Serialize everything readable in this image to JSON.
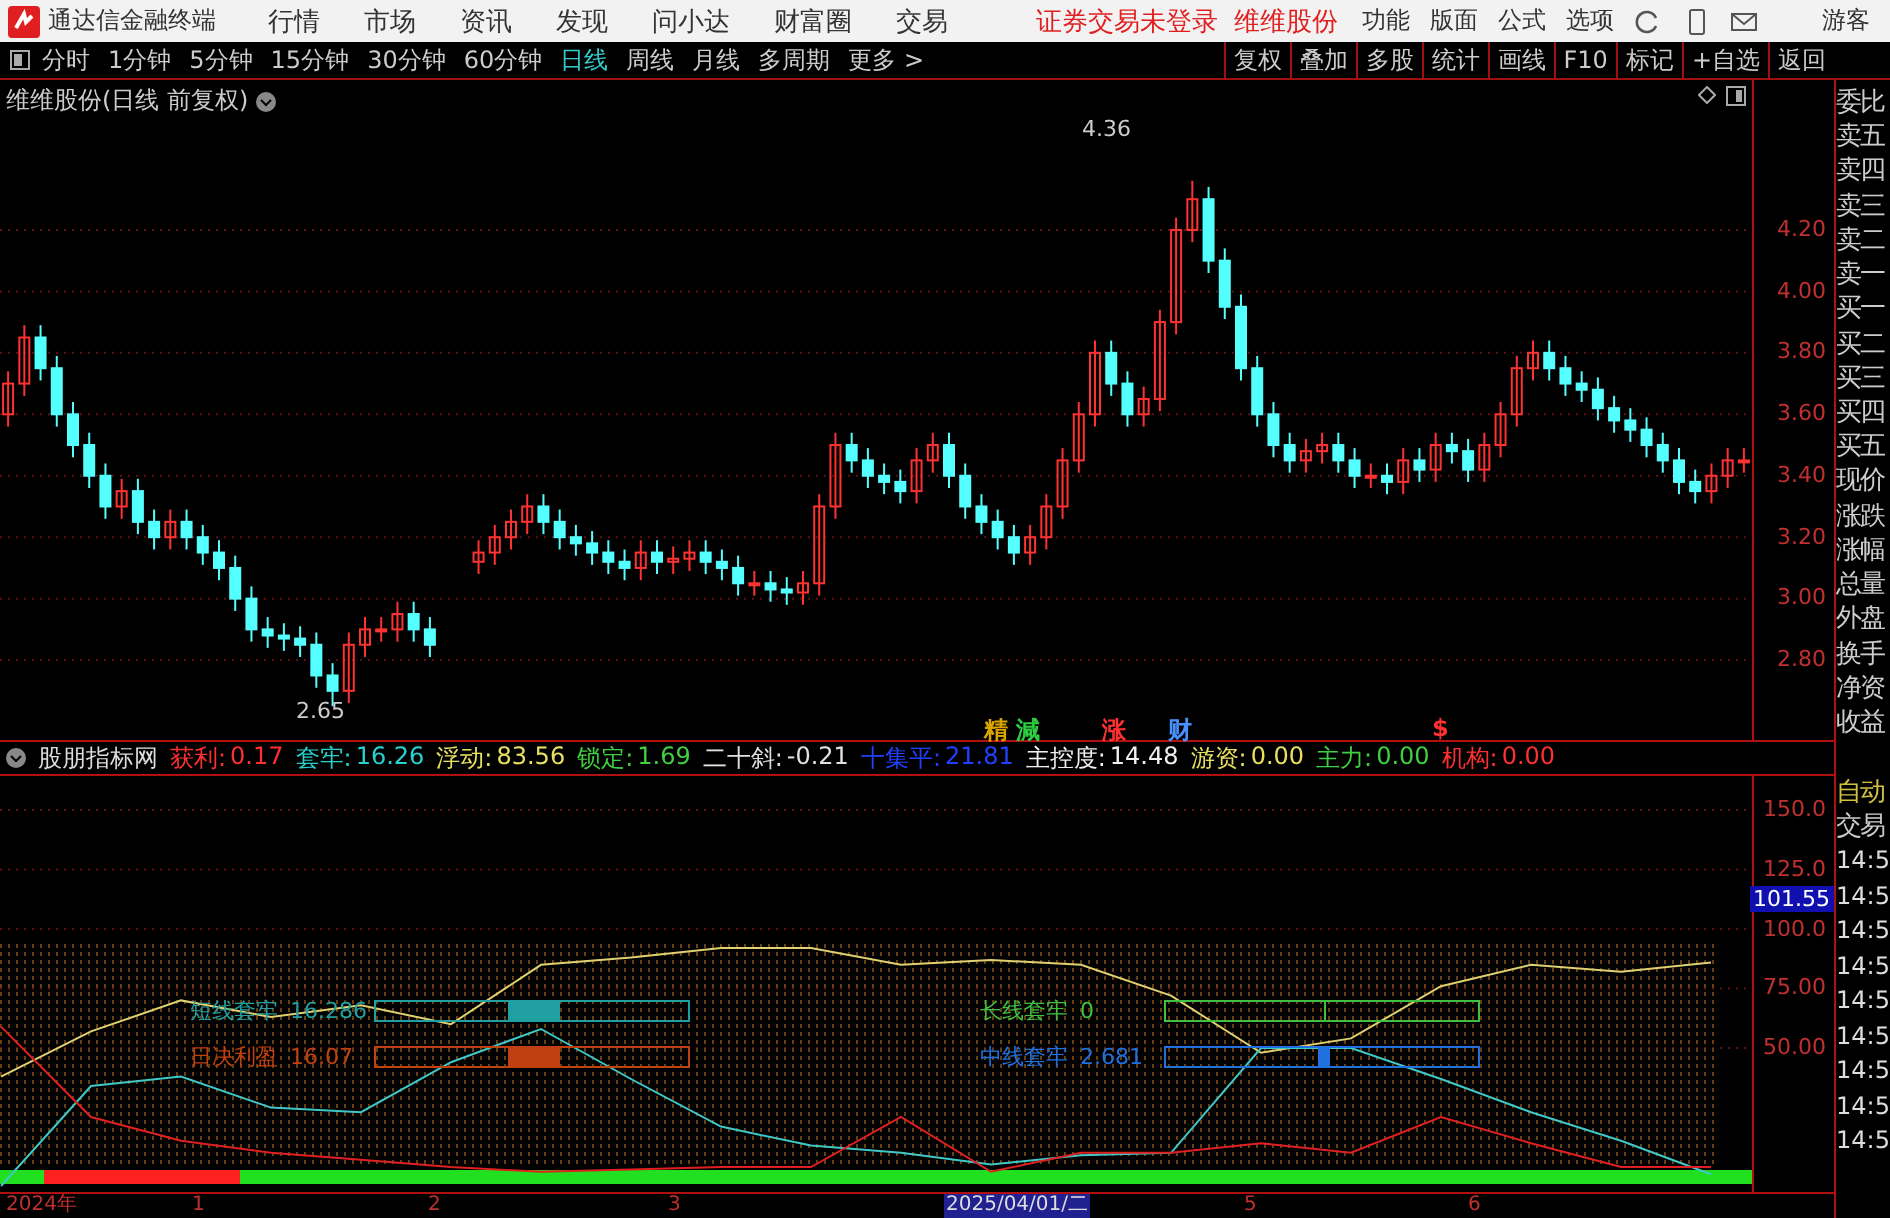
{
  "menu_bar": {
    "app_title": "通达信金融终端",
    "items": [
      "行情",
      "市场",
      "资讯",
      "发现",
      "问小达",
      "财富圈",
      "交易"
    ],
    "status": [
      "证券交易未登录",
      "维维股份"
    ],
    "right_items": [
      "功能",
      "版面",
      "公式",
      "选项"
    ],
    "user": "游客"
  },
  "period_tabs": [
    {
      "label": "分时",
      "selected": false
    },
    {
      "label": "1分钟",
      "selected": false
    },
    {
      "label": "5分钟",
      "selected": false
    },
    {
      "label": "15分钟",
      "selected": false
    },
    {
      "label": "30分钟",
      "selected": false
    },
    {
      "label": "60分钟",
      "selected": false
    },
    {
      "label": "日线",
      "selected": true
    },
    {
      "label": "周线",
      "selected": false
    },
    {
      "label": "月线",
      "selected": false
    },
    {
      "label": "多周期",
      "selected": false
    },
    {
      "label": "更多 >",
      "selected": false
    }
  ],
  "tool_buttons": [
    "复权",
    "叠加",
    "多股",
    "统计",
    "画线",
    "F10",
    "标记",
    "+自选",
    "返回"
  ],
  "chart": {
    "title": "维维股份(日线 前复权)",
    "high_label": "4.36",
    "low_label": "2.65",
    "chart_data": {
      "type": "candlestick",
      "ylim": [
        2.54,
        4.688
      ],
      "grid": true,
      "yticks": [
        {
          "value": 4.2,
          "label": "4.20"
        },
        {
          "value": 4.0,
          "label": "4.00"
        },
        {
          "value": 3.8,
          "label": "3.80"
        },
        {
          "value": 3.6,
          "label": "3.60"
        },
        {
          "value": 3.4,
          "label": "3.40"
        },
        {
          "value": 3.2,
          "label": "3.20"
        },
        {
          "value": 3.0,
          "label": "3.00"
        },
        {
          "value": 2.8,
          "label": "2.80"
        }
      ],
      "ohlc": [
        [
          3.6,
          3.74,
          3.56,
          3.7
        ],
        [
          3.7,
          3.89,
          3.66,
          3.85
        ],
        [
          3.85,
          3.89,
          3.71,
          3.75
        ],
        [
          3.75,
          3.79,
          3.56,
          3.6
        ],
        [
          3.6,
          3.64,
          3.46,
          3.5
        ],
        [
          3.5,
          3.54,
          3.36,
          3.4
        ],
        [
          3.4,
          3.44,
          3.26,
          3.3
        ],
        [
          3.3,
          3.39,
          3.26,
          3.35
        ],
        [
          3.35,
          3.39,
          3.21,
          3.25
        ],
        [
          3.25,
          3.29,
          3.16,
          3.2
        ],
        [
          3.2,
          3.29,
          3.16,
          3.25
        ],
        [
          3.25,
          3.29,
          3.16,
          3.2
        ],
        [
          3.2,
          3.24,
          3.11,
          3.15
        ],
        [
          3.15,
          3.19,
          3.06,
          3.1
        ],
        [
          3.1,
          3.14,
          2.96,
          3.0
        ],
        [
          3.0,
          3.04,
          2.86,
          2.9
        ],
        [
          2.9,
          2.94,
          2.84,
          2.88
        ],
        [
          2.88,
          2.92,
          2.83,
          2.87
        ],
        [
          2.87,
          2.91,
          2.81,
          2.85
        ],
        [
          2.85,
          2.89,
          2.71,
          2.75
        ],
        [
          2.75,
          2.79,
          2.65,
          2.7
        ],
        [
          2.7,
          2.89,
          2.66,
          2.85
        ],
        [
          2.85,
          2.94,
          2.81,
          2.9
        ],
        [
          2.9,
          2.94,
          2.86,
          2.9
        ],
        [
          2.9,
          2.99,
          2.86,
          2.95
        ],
        [
          2.95,
          2.99,
          2.86,
          2.9
        ],
        [
          2.9,
          2.94,
          2.81,
          2.85
        ],
        null,
        null,
        [
          3.12,
          3.19,
          3.08,
          3.15
        ],
        [
          3.15,
          3.24,
          3.11,
          3.2
        ],
        [
          3.2,
          3.29,
          3.16,
          3.25
        ],
        [
          3.25,
          3.34,
          3.21,
          3.3
        ],
        [
          3.3,
          3.34,
          3.21,
          3.25
        ],
        [
          3.25,
          3.29,
          3.16,
          3.2
        ],
        [
          3.2,
          3.24,
          3.14,
          3.18
        ],
        [
          3.18,
          3.22,
          3.11,
          3.15
        ],
        [
          3.15,
          3.19,
          3.08,
          3.12
        ],
        [
          3.12,
          3.16,
          3.06,
          3.1
        ],
        [
          3.1,
          3.19,
          3.06,
          3.15
        ],
        [
          3.15,
          3.19,
          3.08,
          3.12
        ],
        [
          3.12,
          3.17,
          3.08,
          3.13
        ],
        [
          3.13,
          3.19,
          3.09,
          3.15
        ],
        [
          3.15,
          3.19,
          3.08,
          3.12
        ],
        [
          3.12,
          3.16,
          3.06,
          3.1
        ],
        [
          3.1,
          3.14,
          3.01,
          3.05
        ],
        [
          3.05,
          3.09,
          3.01,
          3.05
        ],
        [
          3.05,
          3.09,
          2.99,
          3.03
        ],
        [
          3.03,
          3.07,
          2.98,
          3.02
        ],
        [
          3.02,
          3.09,
          2.98,
          3.05
        ],
        [
          3.05,
          3.34,
          3.01,
          3.3
        ],
        [
          3.3,
          3.54,
          3.26,
          3.5
        ],
        [
          3.5,
          3.54,
          3.41,
          3.45
        ],
        [
          3.45,
          3.49,
          3.36,
          3.4
        ],
        [
          3.4,
          3.44,
          3.34,
          3.38
        ],
        [
          3.38,
          3.42,
          3.31,
          3.35
        ],
        [
          3.35,
          3.49,
          3.31,
          3.45
        ],
        [
          3.45,
          3.54,
          3.41,
          3.5
        ],
        [
          3.5,
          3.54,
          3.36,
          3.4
        ],
        [
          3.4,
          3.44,
          3.26,
          3.3
        ],
        [
          3.3,
          3.34,
          3.21,
          3.25
        ],
        [
          3.25,
          3.29,
          3.16,
          3.2
        ],
        [
          3.2,
          3.24,
          3.11,
          3.15
        ],
        [
          3.15,
          3.24,
          3.11,
          3.2
        ],
        [
          3.2,
          3.34,
          3.16,
          3.3
        ],
        [
          3.3,
          3.49,
          3.26,
          3.45
        ],
        [
          3.45,
          3.64,
          3.41,
          3.6
        ],
        [
          3.6,
          3.84,
          3.56,
          3.8
        ],
        [
          3.8,
          3.84,
          3.66,
          3.7
        ],
        [
          3.7,
          3.74,
          3.56,
          3.6
        ],
        [
          3.6,
          3.69,
          3.56,
          3.65
        ],
        [
          3.65,
          3.94,
          3.61,
          3.9
        ],
        [
          3.9,
          4.24,
          3.86,
          4.2
        ],
        [
          4.2,
          4.36,
          4.16,
          4.3
        ],
        [
          4.3,
          4.34,
          4.06,
          4.1
        ],
        [
          4.1,
          4.14,
          3.91,
          3.95
        ],
        [
          3.95,
          3.99,
          3.71,
          3.75
        ],
        [
          3.75,
          3.79,
          3.56,
          3.6
        ],
        [
          3.6,
          3.64,
          3.46,
          3.5
        ],
        [
          3.5,
          3.54,
          3.41,
          3.45
        ],
        [
          3.45,
          3.52,
          3.41,
          3.48
        ],
        [
          3.48,
          3.54,
          3.44,
          3.5
        ],
        [
          3.5,
          3.54,
          3.41,
          3.45
        ],
        [
          3.45,
          3.49,
          3.36,
          3.4
        ],
        [
          3.4,
          3.44,
          3.36,
          3.4
        ],
        [
          3.4,
          3.44,
          3.34,
          3.38
        ],
        [
          3.38,
          3.49,
          3.34,
          3.45
        ],
        [
          3.45,
          3.49,
          3.38,
          3.42
        ],
        [
          3.42,
          3.54,
          3.38,
          3.5
        ],
        [
          3.5,
          3.54,
          3.44,
          3.48
        ],
        [
          3.48,
          3.52,
          3.38,
          3.42
        ],
        [
          3.42,
          3.54,
          3.38,
          3.5
        ],
        [
          3.5,
          3.64,
          3.46,
          3.6
        ],
        [
          3.6,
          3.79,
          3.56,
          3.75
        ],
        [
          3.75,
          3.84,
          3.71,
          3.8
        ],
        [
          3.8,
          3.84,
          3.71,
          3.75
        ],
        [
          3.75,
          3.79,
          3.66,
          3.7
        ],
        [
          3.7,
          3.74,
          3.64,
          3.68
        ],
        [
          3.68,
          3.72,
          3.58,
          3.62
        ],
        [
          3.62,
          3.66,
          3.54,
          3.58
        ],
        [
          3.58,
          3.62,
          3.51,
          3.55
        ],
        [
          3.55,
          3.59,
          3.46,
          3.5
        ],
        [
          3.5,
          3.54,
          3.41,
          3.45
        ],
        [
          3.45,
          3.49,
          3.34,
          3.38
        ],
        [
          3.38,
          3.42,
          3.31,
          3.35
        ],
        [
          3.35,
          3.44,
          3.31,
          3.4
        ],
        [
          3.4,
          3.49,
          3.36,
          3.45
        ],
        [
          3.45,
          3.49,
          3.41,
          3.45
        ]
      ]
    },
    "event_marks": [
      {
        "text": "精",
        "color": "#d9a400"
      },
      {
        "text": "減",
        "color": "#2ecc40"
      },
      {
        "text": "涨",
        "color": "#ff3030"
      },
      {
        "text": "财",
        "color": "#4a90ff"
      },
      {
        "text": "$",
        "color": "#ff3030"
      }
    ]
  },
  "indicator": {
    "name": "股朋指标网",
    "readings": [
      {
        "label": "获利:",
        "value": "0.17",
        "color": "#ff3030"
      },
      {
        "label": "套牢:",
        "value": "16.26",
        "color": "#2ad0d0"
      },
      {
        "label": "浮动:",
        "value": "83.56",
        "color": "#e8e060"
      },
      {
        "label": "锁定:",
        "value": "1.69",
        "color": "#40d040"
      },
      {
        "label": "二十斜:",
        "value": "-0.21",
        "color": "#e0e0e0"
      },
      {
        "label": "十集平:",
        "value": "21.81",
        "color": "#2040ff"
      },
      {
        "label": "主控度:",
        "value": "14.48",
        "color": "#f0f0f0"
      },
      {
        "label": "游资:",
        "value": "0.00",
        "color": "#e8e060"
      },
      {
        "label": "主力:",
        "value": "0.00",
        "color": "#40d040"
      },
      {
        "label": "机构:",
        "value": "0.00",
        "color": "#ff3030"
      }
    ],
    "current_value": "101.55",
    "chart_data": {
      "type": "line",
      "ylim": [
        -10.5,
        164.3
      ],
      "grid": true,
      "yticks": [
        {
          "value": 150,
          "label": "150.0"
        },
        {
          "value": 125,
          "label": "125.0"
        },
        {
          "value": 100,
          "label": "100.0"
        },
        {
          "value": 75,
          "label": "75.00"
        },
        {
          "value": 50,
          "label": "50.00"
        }
      ],
      "series": [
        {
          "color": "#e0d070",
          "values": [
            38,
            57,
            70,
            63,
            68,
            60,
            85,
            88,
            92,
            92,
            85,
            87,
            85,
            72,
            48,
            54,
            76,
            85,
            82,
            86
          ]
        },
        {
          "color": "#40c8c8",
          "values": [
            -8,
            34,
            38,
            25,
            23,
            44,
            58,
            37,
            17,
            9,
            6,
            1,
            5,
            6,
            50,
            50,
            37,
            23,
            11,
            -3
          ]
        },
        {
          "color": "#e02020",
          "values": [
            59,
            21,
            11,
            6,
            3,
            0,
            -2,
            -1,
            0,
            0,
            21,
            -2,
            6,
            6,
            10,
            6,
            21,
            10,
            0,
            0
          ]
        }
      ]
    },
    "gauges": [
      {
        "label": "短线套牢",
        "value": "16.286",
        "color": "#20a0a0"
      },
      {
        "label": "日决利盈",
        "value": "16.07",
        "color": "#c04010"
      },
      {
        "label": "长线套牢",
        "value": "0",
        "color": "#40c040"
      },
      {
        "label": "中线套牢",
        "value": "2.681",
        "color": "#2070e0"
      }
    ],
    "date_labels": [
      {
        "text": "2024年",
        "selected": false
      },
      {
        "text": "1",
        "selected": false
      },
      {
        "text": "2",
        "selected": false
      },
      {
        "text": "3",
        "selected": false
      },
      {
        "text": "2025/04/01/二",
        "selected": true
      },
      {
        "text": "5",
        "selected": false
      },
      {
        "text": "6",
        "selected": false
      }
    ]
  },
  "side_panel": {
    "quote_labels": [
      "委比",
      "卖五",
      "卖四",
      "卖三",
      "卖二",
      "卖一",
      "买一",
      "买二",
      "买三",
      "买四",
      "买五",
      "现价",
      "涨跌",
      "涨幅",
      "总量",
      "外盘",
      "换手",
      "净资",
      "收益"
    ],
    "trade_labels": [
      "自动",
      "交易"
    ],
    "times": [
      "14:5",
      "14:5",
      "14:5",
      "14:5",
      "14:5",
      "14:5",
      "14:5",
      "14:5",
      "14:5"
    ]
  }
}
